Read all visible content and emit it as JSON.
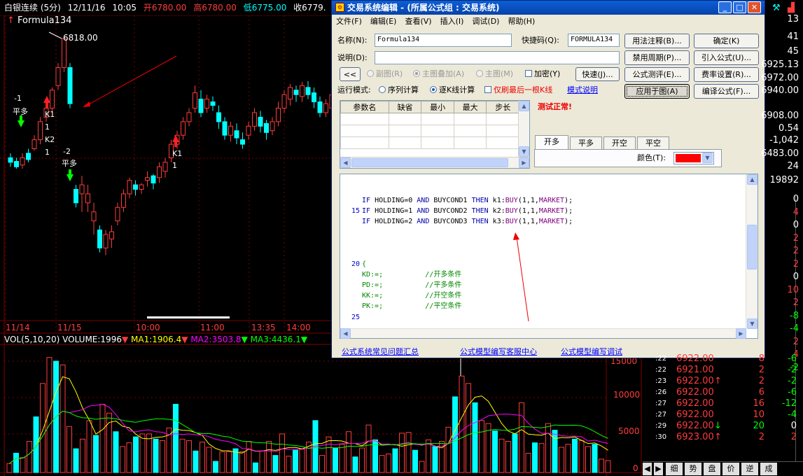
{
  "header": {
    "instrument": "白银连续 (5分)",
    "date": "12/11/16",
    "time": "10:05",
    "open": "开6780.00",
    "high": "高6780.00",
    "low": "低6775.00",
    "close": "收6779.",
    "formula_name": "Formula134"
  },
  "chart_labels": {
    "peak_price": "6818.00",
    "sig1": [
      "-1",
      "平多",
      "K1",
      "1",
      "K2",
      "1"
    ],
    "sig2": [
      "-2",
      "平多"
    ],
    "sig3": [
      "K1",
      "1"
    ],
    "time_axis": [
      "11/14",
      "11/15",
      "10:00",
      "11:00",
      "13:35",
      "14:00"
    ]
  },
  "volume": {
    "title": "VOL(5,10,20)",
    "volume_label": "VOLUME:1996",
    "ma1": "MA1:1906.4",
    "ma2": "MA2:3503.8",
    "ma3": "MA3:4436.1",
    "axis": [
      "15000",
      "10000",
      "5000",
      "0"
    ]
  },
  "dialog": {
    "title": "交易系统编辑 - (所属公式组 : 交易系统)",
    "menu": [
      "文件(F)",
      "编辑(E)",
      "查看(V)",
      "插入(I)",
      "调试(D)",
      "帮助(H)"
    ],
    "name_label": "名称(N):",
    "name_value": "Formula134",
    "shortcut_label": "快捷码(Q):",
    "shortcut_value": "FORMULA134",
    "desc_label": "说明(D):",
    "desc_value": "",
    "collapse_btn": "<<",
    "view_opts": [
      "副图(R)",
      "主图叠加(A)",
      "主图(M)"
    ],
    "encrypt_label": "加密(Y)",
    "fast_btn": "快速(J)...",
    "run_mode_label": "运行模式:",
    "run_modes": [
      "序列计算",
      "逐K线计算"
    ],
    "refresh_last_label": "仅刷最后一根K线",
    "mode_help_link": "模式说明",
    "buttons_left": [
      "用法注释(B)...",
      "禁用周期(P)...",
      "公式测评(E)...",
      "应用于图(A)"
    ],
    "buttons_right": [
      "确定(K)",
      "引入公式(U)...",
      "费率设置(R)...",
      "编译公式(F)..."
    ],
    "param_headers": [
      "参数名",
      "缺省",
      "最小",
      "最大",
      "步长"
    ],
    "test_status": "测试正常!",
    "tabs": [
      "开多",
      "平多",
      "开空",
      "平空"
    ],
    "color_label": "颜色(T):",
    "color_value": "#ff0000",
    "code_lines": [
      {
        "ln": "",
        "text": "IF HOLDING=0 AND BUYCOND1 THEN k1:BUY(1,1,MARKET);"
      },
      {
        "ln": "15",
        "text": "IF HOLDING=1 AND BUYCOND2 THEN k2:BUY(1,1,MARKET);"
      },
      {
        "ln": "",
        "text": "IF HOLDING=2 AND BUYCOND3 THEN k3:BUY(1,1,MARKET);"
      },
      {
        "ln": "20",
        "text": "{"
      },
      {
        "ln": "",
        "text": "KD:=;          //开多条件"
      },
      {
        "ln": "",
        "text": "PD:=;          //平多条件"
      },
      {
        "ln": "",
        "text": "KK:=;          //开空条件"
      },
      {
        "ln": "",
        "text": "PK:=;          //平空条件"
      },
      {
        "ln": "25",
        "text": ""
      }
    ],
    "links": [
      "公式系统常见问题汇总",
      "公式模型编写客服中心",
      "公式模型编写调试"
    ]
  },
  "right_panel": {
    "top_values": [
      "13",
      "41",
      "45",
      "6925.13",
      "6972.00",
      "6940.00",
      "6908.00",
      "0.54",
      "-1,042",
      "6483.00",
      "24",
      "19892"
    ],
    "column_values": [
      "0",
      "4",
      "0",
      "2",
      "2",
      "2",
      "0",
      "10",
      "2",
      "-8",
      "-4",
      "2",
      "4",
      "-2"
    ],
    "ticks": [
      {
        "t": ":22",
        "price": "6922.00",
        "arrow": "",
        "vol": "8",
        "chg": "-6"
      },
      {
        "t": ":22",
        "price": "6921.00",
        "arrow": "",
        "vol": "2",
        "chg": "-2"
      },
      {
        "t": ":23",
        "price": "6922.00",
        "arrow": "↑",
        "vol": "2",
        "chg": "-2"
      },
      {
        "t": ":26",
        "price": "6922.00",
        "arrow": "",
        "vol": "6",
        "chg": "-6"
      },
      {
        "t": ":27",
        "price": "6922.00",
        "arrow": "",
        "vol": "16",
        "chg": "-12"
      },
      {
        "t": ":27",
        "price": "6922.00",
        "arrow": "",
        "vol": "10",
        "chg": "-4"
      },
      {
        "t": ":29",
        "price": "6922.00",
        "arrow": "↓",
        "vol": "20",
        "chg": "0"
      },
      {
        "t": ":30",
        "price": "6923.00",
        "arrow": "↑",
        "vol": "2",
        "chg": "2"
      }
    ],
    "bottom_tabs": [
      "细",
      "势",
      "盘",
      "价",
      "逆",
      "成"
    ]
  },
  "colors": {
    "up": "#ff3c3c",
    "down": "#00ffff",
    "ma1": "#ffff00",
    "ma2": "#ff00ff",
    "ma3": "#00ff00",
    "dialog_bg": "#ece9d8"
  }
}
